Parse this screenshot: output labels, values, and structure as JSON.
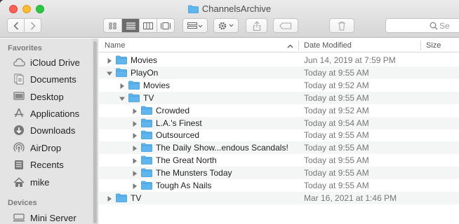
{
  "window": {
    "title": "ChannelsArchive"
  },
  "toolbar": {
    "search_placeholder": "Se"
  },
  "sidebar": {
    "sections": [
      {
        "heading": "Favorites"
      },
      {
        "heading": "Devices"
      }
    ],
    "items": [
      {
        "label": "iCloud Drive",
        "icon": "cloud-icon"
      },
      {
        "label": "Documents",
        "icon": "document-icon"
      },
      {
        "label": "Desktop",
        "icon": "desktop-icon"
      },
      {
        "label": "Applications",
        "icon": "applications-icon"
      },
      {
        "label": "Downloads",
        "icon": "download-icon"
      },
      {
        "label": "AirDrop",
        "icon": "airdrop-icon"
      },
      {
        "label": "Recents",
        "icon": "recents-icon"
      },
      {
        "label": "mike",
        "icon": "home-icon"
      },
      {
        "label": "Mini Server",
        "icon": "computer-icon"
      }
    ]
  },
  "columns": {
    "name": "Name",
    "date": "Date Modified",
    "size": "Size"
  },
  "rows": [
    {
      "name": "Movies",
      "date": "Jun 14, 2019 at 7:59 PM",
      "level": 0,
      "expanded": false
    },
    {
      "name": "PlayOn",
      "date": "Today at 9:55 AM",
      "level": 0,
      "expanded": true
    },
    {
      "name": "Movies",
      "date": "Today at 9:52 AM",
      "level": 1,
      "expanded": false
    },
    {
      "name": "TV",
      "date": "Today at 9:55 AM",
      "level": 1,
      "expanded": true
    },
    {
      "name": "Crowded",
      "date": "Today at 9:52 AM",
      "level": 2,
      "expanded": false
    },
    {
      "name": "L.A.'s Finest",
      "date": "Today at 9:54 AM",
      "level": 2,
      "expanded": false
    },
    {
      "name": "Outsourced",
      "date": "Today at 9:55 AM",
      "level": 2,
      "expanded": false
    },
    {
      "name": "The Daily Show...endous Scandals!",
      "date": "Today at 9:55 AM",
      "level": 2,
      "expanded": false
    },
    {
      "name": "The Great North",
      "date": "Today at 9:55 AM",
      "level": 2,
      "expanded": false
    },
    {
      "name": "The Munsters Today",
      "date": "Today at 9:55 AM",
      "level": 2,
      "expanded": false
    },
    {
      "name": "Tough As Nails",
      "date": "Today at 9:55 AM",
      "level": 2,
      "expanded": false
    },
    {
      "name": "TV",
      "date": "Mar 16, 2021 at 1:46 PM",
      "level": 0,
      "expanded": false
    }
  ],
  "colors": {
    "folder": "#5fb6ee",
    "folder_dark": "#3f9ad8",
    "alt_row": "#f4f5f5"
  }
}
